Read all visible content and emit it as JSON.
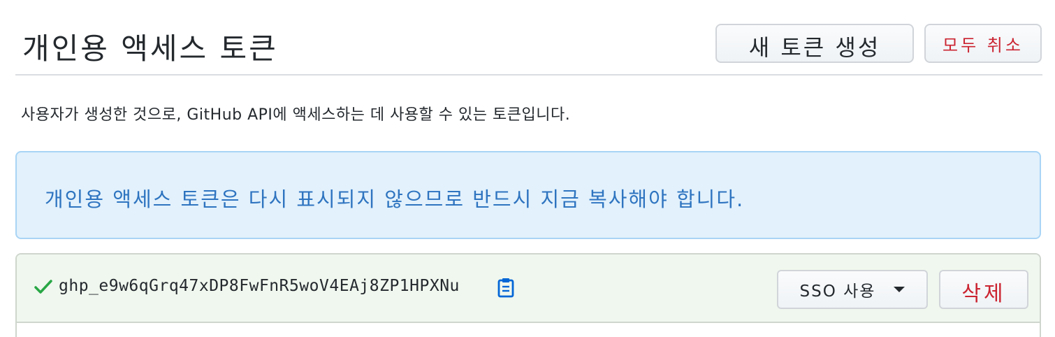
{
  "header": {
    "title": "개인용 액세스 토큰",
    "new_token_label": "새 토큰 생성",
    "revoke_all_label": "모두 취소"
  },
  "subtitle": "사용자가 생성한 것으로, GitHub API에 액세스하는 데 사용할 수 있는 토큰입니다.",
  "flash": {
    "message": "개인용 액세스 토큰은 다시 표시되지 않으므로 반드시 지금 복사해야 합니다."
  },
  "token": {
    "value": "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",
    "sso_label": "SSO 사용",
    "delete_label": "삭제",
    "icons": {
      "status": "check-icon",
      "copy": "clipboard-icon",
      "dropdown": "caret-down-icon"
    }
  },
  "colors": {
    "danger": "#cb2431",
    "info_text": "#2e74c0",
    "info_bg": "#e2f1fc",
    "success_bg": "#f0f7ee",
    "check": "#28a745",
    "clipboard": "#0366d6"
  }
}
